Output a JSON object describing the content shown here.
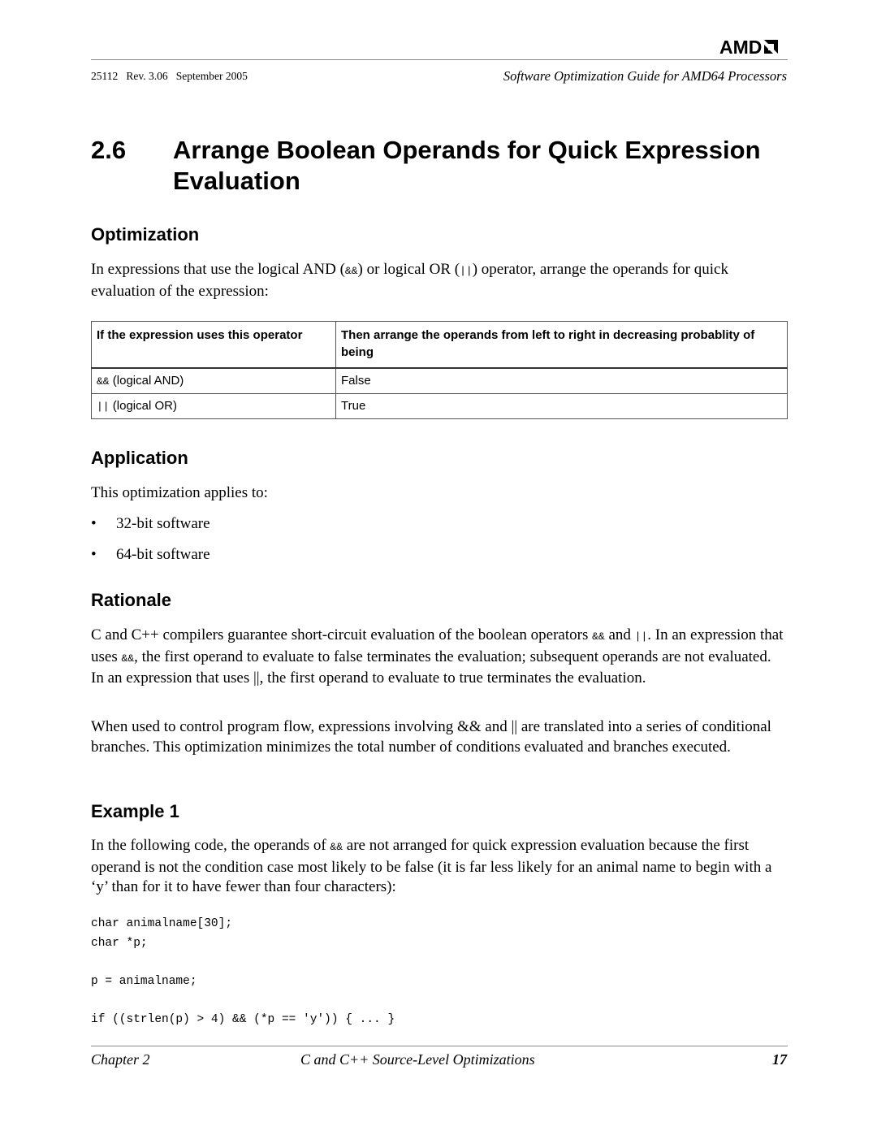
{
  "header": {
    "logo_text": "AMD",
    "doc_info": "25112   Rev. 3.06   September 2005",
    "doc_title": "Software Optimization Guide for AMD64 Processors"
  },
  "section": {
    "number": "2.6",
    "title": "Arrange Boolean Operands for Quick Expression Evaluation"
  },
  "optimization": {
    "heading": "Optimization",
    "intro_1": "In expressions that use the logical AND (",
    "intro_and": "&&",
    "intro_2": ") or logical OR (",
    "intro_or": "||",
    "intro_3": ") operator, arrange the operands for quick evaluation of the expression:",
    "table": {
      "headers": [
        "If the expression uses this operator",
        "Then arrange the operands from left to right in decreasing probablity of being"
      ],
      "rows": [
        {
          "op": "&&",
          "op_label": " (logical AND)",
          "value": "False"
        },
        {
          "op": "||",
          "op_label": " (logical OR)",
          "value": "True"
        }
      ]
    }
  },
  "application": {
    "heading": "Application",
    "intro": "This optimization applies to:",
    "bullets": [
      "32-bit software",
      "64-bit software"
    ],
    "bullet_glyph": "•"
  },
  "rationale": {
    "heading": "Rationale",
    "p1_a": "C and C++ compilers guarantee short-circuit evaluation of the boolean operators ",
    "p1_and": "&&",
    "p1_b": " and ",
    "p1_or": "||",
    "p1_c": ". In an expression that uses ",
    "p1_and2": "&&",
    "p1_d": ", the first operand to evaluate to false terminates the evaluation; subsequent operands are not evaluated. In an expression that uses ||, the first operand to evaluate to true terminates the evaluation.",
    "p2": "When used to control program flow, expressions involving && and || are translated into a series of conditional branches. This optimization minimizes the total number of conditions evaluated and branches executed."
  },
  "example": {
    "heading": "Example 1",
    "p_a": "In the following code, the operands of ",
    "p_and": "&&",
    "p_b": " are not arranged for quick expression evaluation because the first operand is not the condition case most likely to be false (it is far less likely for an animal name to begin with a ‘y’ than for it to have fewer than four characters):",
    "code": "char animalname[30];\nchar *p;\n\np = animalname;\n\nif ((strlen(p) > 4) && (*p == 'y')) { ... }"
  },
  "footer": {
    "chapter": "Chapter 2",
    "chapter_title": "C and C++ Source-Level Optimizations",
    "page_number": "17"
  }
}
